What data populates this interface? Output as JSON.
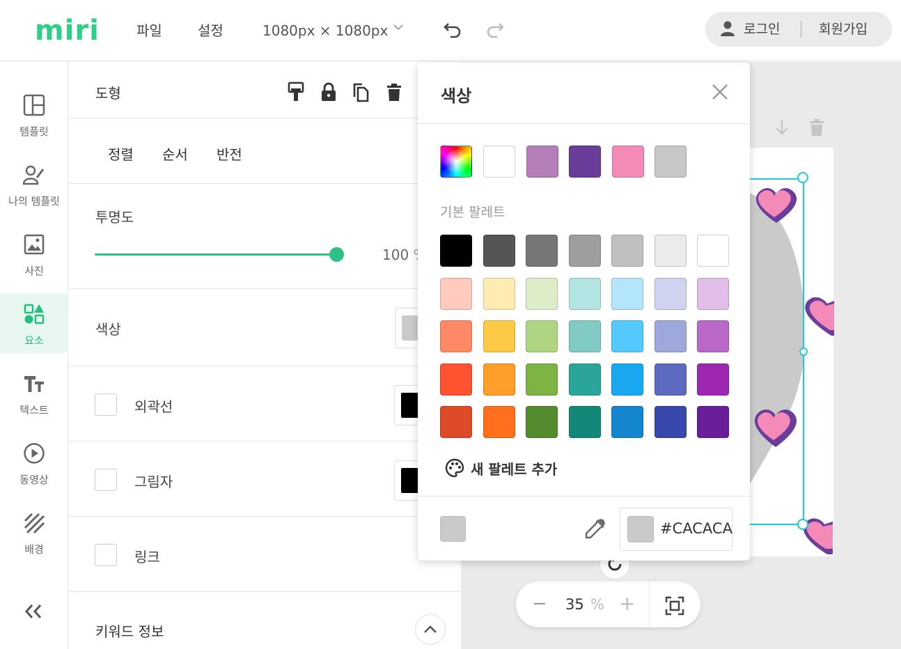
{
  "header": {
    "logo": "miri",
    "menu": [
      "파일",
      "설정"
    ],
    "canvas_size": "1080px × 1080px",
    "login": "로그인",
    "signup": "회원가입"
  },
  "nav": [
    {
      "label": "템플릿",
      "icon": "layout-icon"
    },
    {
      "label": "나의 템플릿",
      "icon": "my-template-icon"
    },
    {
      "label": "사진",
      "icon": "photo-icon"
    },
    {
      "label": "요소",
      "icon": "elements-icon",
      "active": true
    },
    {
      "label": "텍스트",
      "icon": "text-icon"
    },
    {
      "label": "동영상",
      "icon": "video-icon"
    },
    {
      "label": "배경",
      "icon": "background-icon"
    }
  ],
  "panel": {
    "title": "도형",
    "tabs": [
      "정렬",
      "순서",
      "반전"
    ],
    "opacity_label": "투명도",
    "opacity_value": "100",
    "opacity_unit": "%",
    "opacity_fraction": 1.0,
    "color_label": "색상",
    "outline_label": "외곽선",
    "shadow_label": "그림자",
    "link_label": "링크",
    "keyword_label": "키워드 정보"
  },
  "zoom": {
    "value": "35",
    "unit": "%"
  },
  "color_popup": {
    "title": "색상",
    "recent_colors": [
      "#ffffff",
      "#b57eb8",
      "#6a3d9a",
      "#f48ab8",
      "#c8c8c8"
    ],
    "palette_label": "기본 팔레트",
    "palette": [
      [
        "#000000",
        "#555555",
        "#777777",
        "#9e9e9e",
        "#c0c0c0",
        "#ebebeb",
        "#ffffff"
      ],
      [
        "#ffcbbd",
        "#ffecb3",
        "#dcedc8",
        "#b2e5e1",
        "#b3e5fc",
        "#cfd3f0",
        "#e1bee7"
      ],
      [
        "#ff8a65",
        "#ffca47",
        "#aed581",
        "#80cbc4",
        "#55c8fd",
        "#9fa8da",
        "#ba68c8"
      ],
      [
        "#ff5230",
        "#ff9e28",
        "#7cb342",
        "#2ba59a",
        "#18a8f0",
        "#5c6bc0",
        "#9c27b0"
      ],
      [
        "#dd4b26",
        "#ff6f1e",
        "#558b2f",
        "#128878",
        "#1486d0",
        "#3949ab",
        "#6a1f9a"
      ]
    ],
    "add_palette": "새 팔레트 추가",
    "current_hex": "#CACACA"
  }
}
